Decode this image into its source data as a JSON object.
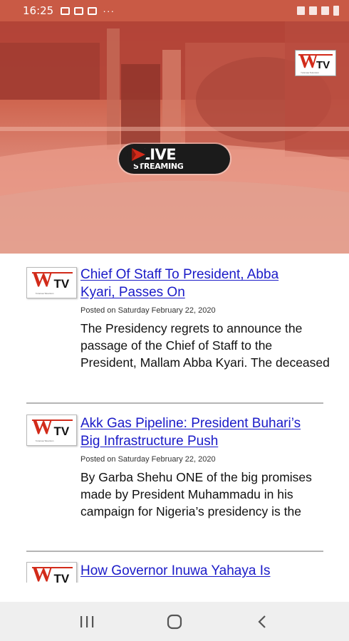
{
  "status_bar": {
    "time": "16:25",
    "dots": "···",
    "left_icons": [
      "image-icon",
      "chat-icon",
      "mail-icon"
    ],
    "right_icons": [
      "alarm-icon",
      "wifi-icon",
      "signal-icon",
      "battery-icon"
    ]
  },
  "hero": {
    "live_title": "LIVE",
    "live_subtitle": "STREAMING",
    "accent_color": "#d22b1a"
  },
  "brand": {
    "logo_w": "W",
    "logo_tv": "TV",
    "logo_tagline": "Yuramaa Television"
  },
  "articles": [
    {
      "title": "Chief Of Staff To President, Abba Kyari, Passes On",
      "title_lines": [
        "Chief Of Staff To President, Abba",
        "Kyari, Passes On"
      ],
      "date": "Posted on Saturday February 22, 2020",
      "excerpt": "The Presidency regrets to announce the passage of the Chief of Staff to the President, Mallam Abba Kyari. The deceased"
    },
    {
      "title": "Akk Gas Pipeline: President Buhari's Big Infrastructure Push",
      "title_lines": [
        "Akk Gas Pipeline: President Buhari’s",
        "Big Infrastructure Push"
      ],
      "date": "Posted on Saturday February 22, 2020",
      "excerpt": "By Garba Shehu ONE of the big promises made by President Muhammadu in his campaign for Nigeria’s presidency is the"
    },
    {
      "title": "How Governor Inuwa Yahaya Is",
      "title_lines": [
        "How Governor Inuwa Yahaya Is"
      ],
      "date": "",
      "excerpt": ""
    }
  ],
  "nav": {
    "buttons": [
      "recent-apps",
      "home",
      "back"
    ]
  }
}
